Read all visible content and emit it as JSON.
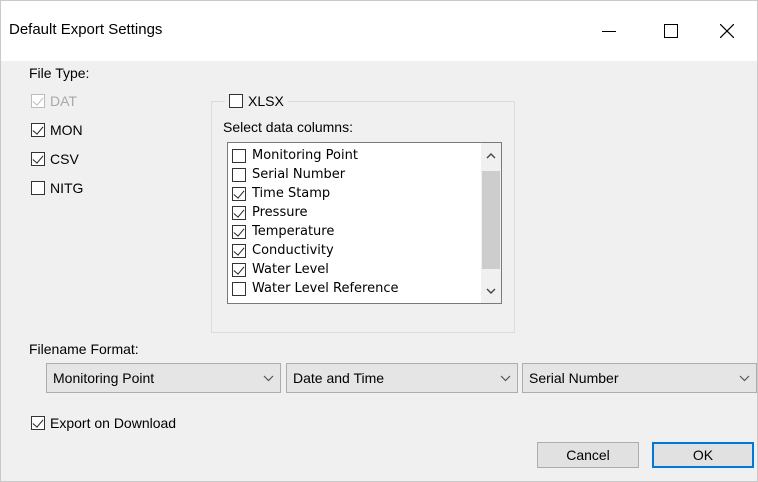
{
  "window": {
    "title": "Default Export Settings"
  },
  "file_type": {
    "label": "File Type:",
    "options": [
      {
        "label": "DAT",
        "checked": true,
        "disabled": true
      },
      {
        "label": "MON",
        "checked": true,
        "disabled": false
      },
      {
        "label": "CSV",
        "checked": true,
        "disabled": false
      },
      {
        "label": "NITG",
        "checked": false,
        "disabled": false
      }
    ]
  },
  "xlsx": {
    "label": "XLSX",
    "checked": false,
    "select_label": "Select data columns:",
    "columns": [
      {
        "label": "Monitoring Point",
        "checked": false
      },
      {
        "label": "Serial Number",
        "checked": false
      },
      {
        "label": "Time Stamp",
        "checked": true
      },
      {
        "label": "Pressure",
        "checked": true
      },
      {
        "label": "Temperature",
        "checked": true
      },
      {
        "label": "Conductivity",
        "checked": true
      },
      {
        "label": "Water Level",
        "checked": true
      },
      {
        "label": "Water Level Reference",
        "checked": false
      }
    ]
  },
  "filename_format": {
    "label": "Filename Format:",
    "part1": "Monitoring Point",
    "part2": "Date and Time",
    "part3": "Serial Number"
  },
  "export_on_download": {
    "label": "Export on Download",
    "checked": true
  },
  "buttons": {
    "cancel": "Cancel",
    "ok": "OK"
  }
}
